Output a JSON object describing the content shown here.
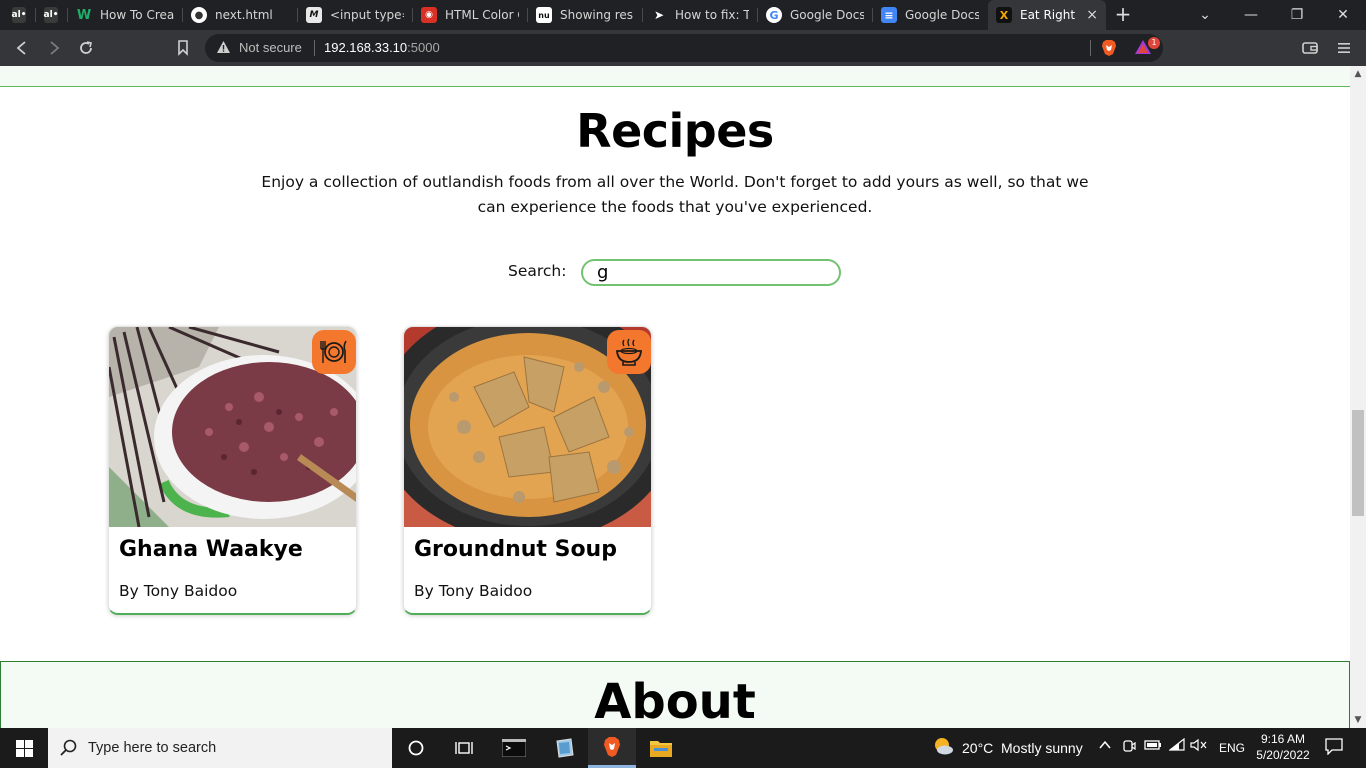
{
  "browser": {
    "tabs": [
      {
        "favicon_text": "al•",
        "title": "",
        "favicon_color": "#3a3a3a"
      },
      {
        "favicon_text": "al•",
        "title": "",
        "favicon_color": "#3a3a3a"
      },
      {
        "favicon_text": "W",
        "title": "How To Create",
        "favicon_color": "#1a8a5a"
      },
      {
        "favicon_text": "●",
        "title": "next.html",
        "favicon_color": "#666666"
      },
      {
        "favicon_text": "M",
        "title": "<input type=\"",
        "favicon_color": "#111111"
      },
      {
        "favicon_text": "◉",
        "title": "HTML Color Co",
        "favicon_color": "#d93025"
      },
      {
        "favicon_text": "nu",
        "title": "Showing result",
        "favicon_color": "#111111"
      },
      {
        "favicon_text": "➤",
        "title": "How to fix: The",
        "favicon_color": "#222222"
      },
      {
        "favicon_text": "G",
        "title": "Google Docs: C",
        "favicon_color": "#ffffff"
      },
      {
        "favicon_text": "≡",
        "title": "Google Docs",
        "favicon_color": "#4285f4"
      },
      {
        "favicon_text": "X",
        "title": "Eat Right",
        "favicon_color": "#f2a900"
      }
    ],
    "active_tab_close": "×",
    "new_tab": "+",
    "window_controls": {
      "dropdown": "⌄",
      "minimize": "—",
      "restore": "❐",
      "close": "✕"
    },
    "address": {
      "security_label": "Not secure",
      "host": "192.168.33.10",
      "port": ":5000"
    },
    "rewards_badge": "1"
  },
  "page": {
    "recipes": {
      "title": "Recipes",
      "intro": "Enjoy a collection of outlandish foods from all over the World. Don't forget to add yours as well, so that we can experience the foods that you've experienced.",
      "search_label": "Search:",
      "search_value": "g"
    },
    "cards": [
      {
        "title": "Ghana Waakye",
        "author": "By Tony Baidoo",
        "badge_icon": "plate-cutlery-icon"
      },
      {
        "title": "Groundnut Soup",
        "author": "By Tony Baidoo",
        "badge_icon": "soup-bowl-icon"
      }
    ],
    "about": {
      "title": "About"
    }
  },
  "taskbar": {
    "search_placeholder": "Type here to search",
    "weather_temp": "20°C",
    "weather_desc": "Mostly sunny",
    "language": "ENG",
    "time": "9:16 AM",
    "date": "5/20/2022"
  },
  "colors": {
    "accent_green": "#5cb85c",
    "badge_orange": "#f4772e",
    "browser_dark": "#202124"
  }
}
